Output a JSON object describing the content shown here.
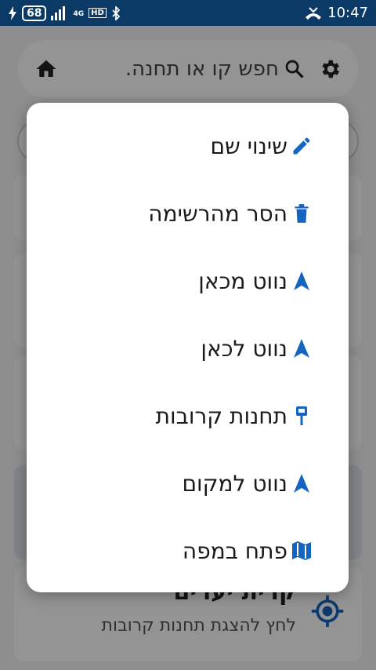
{
  "status_bar": {
    "battery": "68",
    "network": "4G",
    "hd": "HD",
    "time": "10:47"
  },
  "search": {
    "placeholder": "חפש קו או תחנה."
  },
  "background_card": {
    "stop_name": "קרית יערים",
    "subtitle": "לחץ להצגת תחנות קרובות"
  },
  "menu": {
    "items": [
      {
        "label": "שינוי שם",
        "icon": "pencil-icon"
      },
      {
        "label": "הסר מהרשימה",
        "icon": "trash-icon"
      },
      {
        "label": "נווט מכאן",
        "icon": "navigation-arrow-icon"
      },
      {
        "label": "נווט לכאן",
        "icon": "navigation-arrow-icon"
      },
      {
        "label": "תחנות קרובות",
        "icon": "bus-stop-sign-icon"
      },
      {
        "label": "נווט למקום",
        "icon": "navigation-arrow-icon"
      },
      {
        "label": "פתח במפה",
        "icon": "map-icon"
      }
    ]
  },
  "colors": {
    "status_bar": "#0b3a66",
    "icon_blue": "#1565c0",
    "text": "#1a1a1a"
  }
}
